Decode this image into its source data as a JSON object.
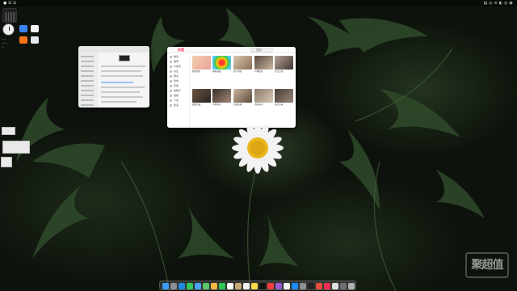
{
  "menubar": {
    "left_text": "●  ☰  ☱",
    "right_text": "▤ ◎ ≡ ◐ ◎ ◉"
  },
  "desktop": {
    "file_label_1": "——",
    "file_label_2": "——",
    "file_label_3": "—"
  },
  "video_app": {
    "title": "抖音",
    "search_placeholder": "搜索",
    "nav_items": [
      "精选",
      "推荐",
      "AI搜索",
      "关注",
      "朋友",
      "我的",
      "直播",
      "放映厅",
      "短剧",
      "下载",
      "更多"
    ],
    "cards_row1": [
      "图文推荐",
      "精彩视频",
      "热门内容",
      "人物访谈",
      "生活日常"
    ],
    "cards_row2": [
      "视频合集",
      "人物专访",
      "影视剪辑",
      "新闻资讯",
      "综艺片段"
    ]
  },
  "watermark": "聚超值",
  "colors": {
    "brand_red": "#ff2c55",
    "dock_bg": "#5a5a5a"
  },
  "icons": {
    "dock": [
      "finder-icon",
      "launchpad-icon",
      "safari-icon",
      "messages-icon",
      "mail-icon",
      "maps-icon",
      "photos-icon",
      "facetime-icon",
      "calendar-icon",
      "contacts-icon",
      "reminders-icon",
      "notes-icon",
      "tv-icon",
      "music-icon",
      "podcasts-icon",
      "news-icon",
      "appstore-icon",
      "settings-icon",
      "terminal-icon",
      "chrome-icon",
      "app-icon",
      "app-icon",
      "app-icon",
      "trash-icon"
    ]
  }
}
